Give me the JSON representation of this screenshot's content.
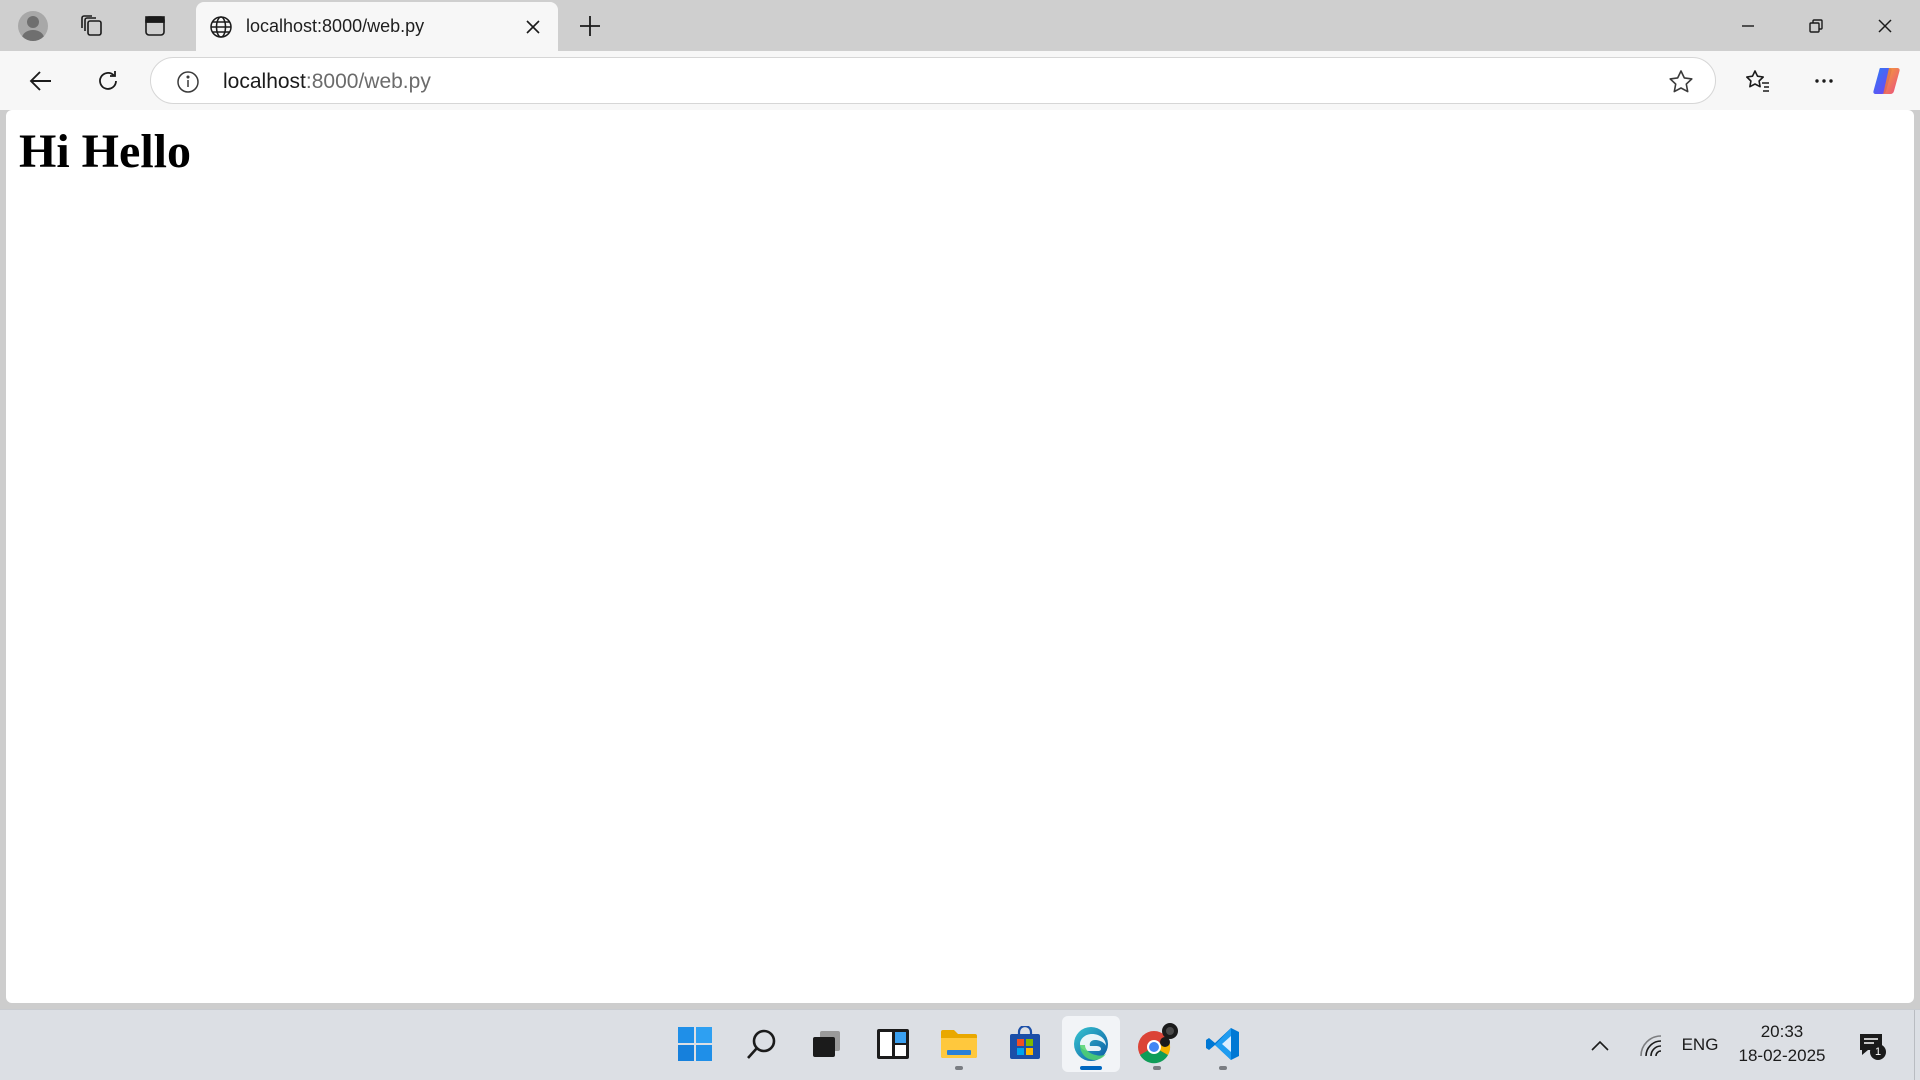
{
  "browser": {
    "tab": {
      "title": "localhost:8000/web.py"
    },
    "address_bar": {
      "url_host": "localhost",
      "url_rest": ":8000/web.py"
    }
  },
  "page": {
    "heading": "Hi Hello"
  },
  "taskbar": {
    "apps": [
      "windows-start-icon",
      "search-icon",
      "task-view-icon",
      "widgets-icon",
      "file-explorer-icon",
      "microsoft-store-icon",
      "edge-icon",
      "chrome-icon",
      "vscode-icon"
    ],
    "language": "ENG",
    "time": "20:33",
    "date": "18-02-2025",
    "notification_count": "1"
  },
  "colors": {
    "accent": "#0067c0",
    "titlebar_bg": "#cfcfcf",
    "toolbar_bg": "#f7f7f7",
    "taskbar_bg": "#dcdfe4"
  }
}
